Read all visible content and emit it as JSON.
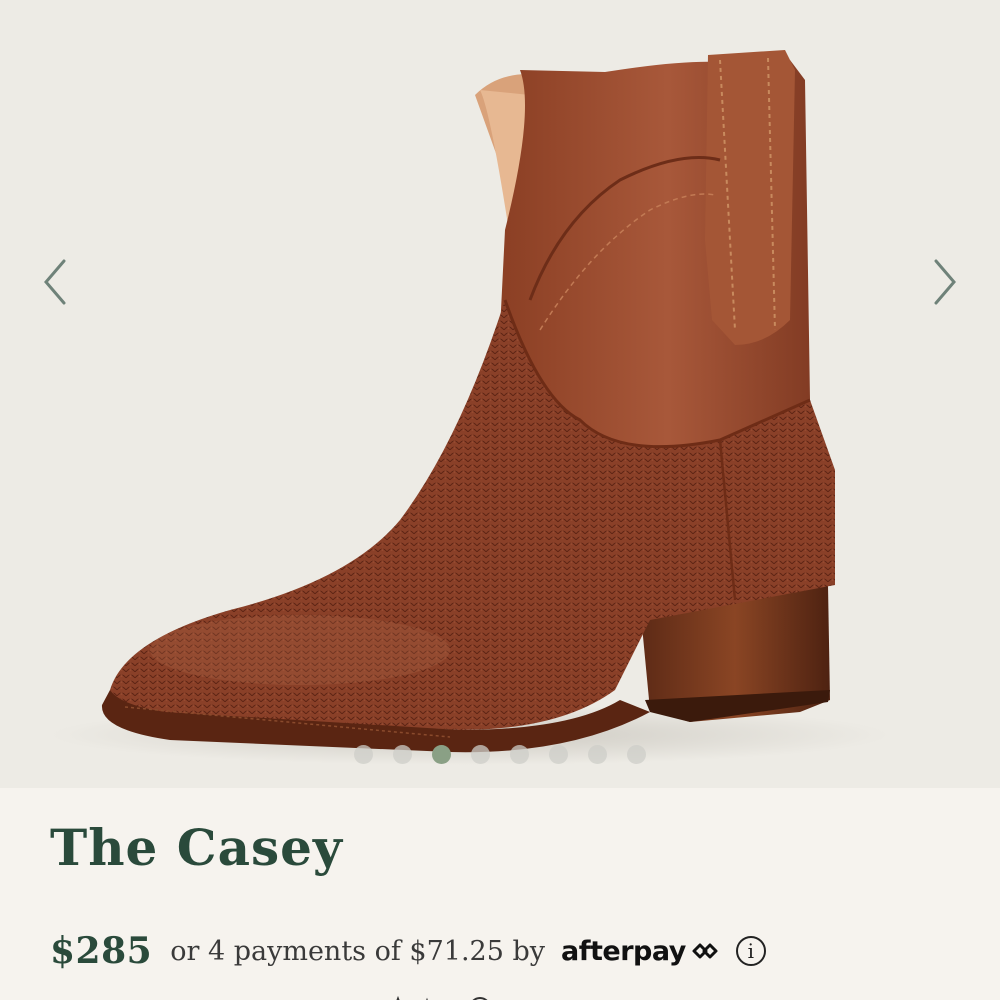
{
  "product": {
    "name": "The Casey",
    "price": "$285",
    "installments_text": "or 4 payments of $71.25 by",
    "payment_provider": "afterpay",
    "info_icon": "i"
  },
  "gallery": {
    "prev_icon": "chevron-left-icon",
    "next_icon": "chevron-right-icon",
    "slide_count": 8,
    "active_slide": 3
  },
  "colors": {
    "brand_green": "#2a4a3b",
    "active_dot": "#8aa085",
    "gallery_bg": "#edebe5"
  }
}
